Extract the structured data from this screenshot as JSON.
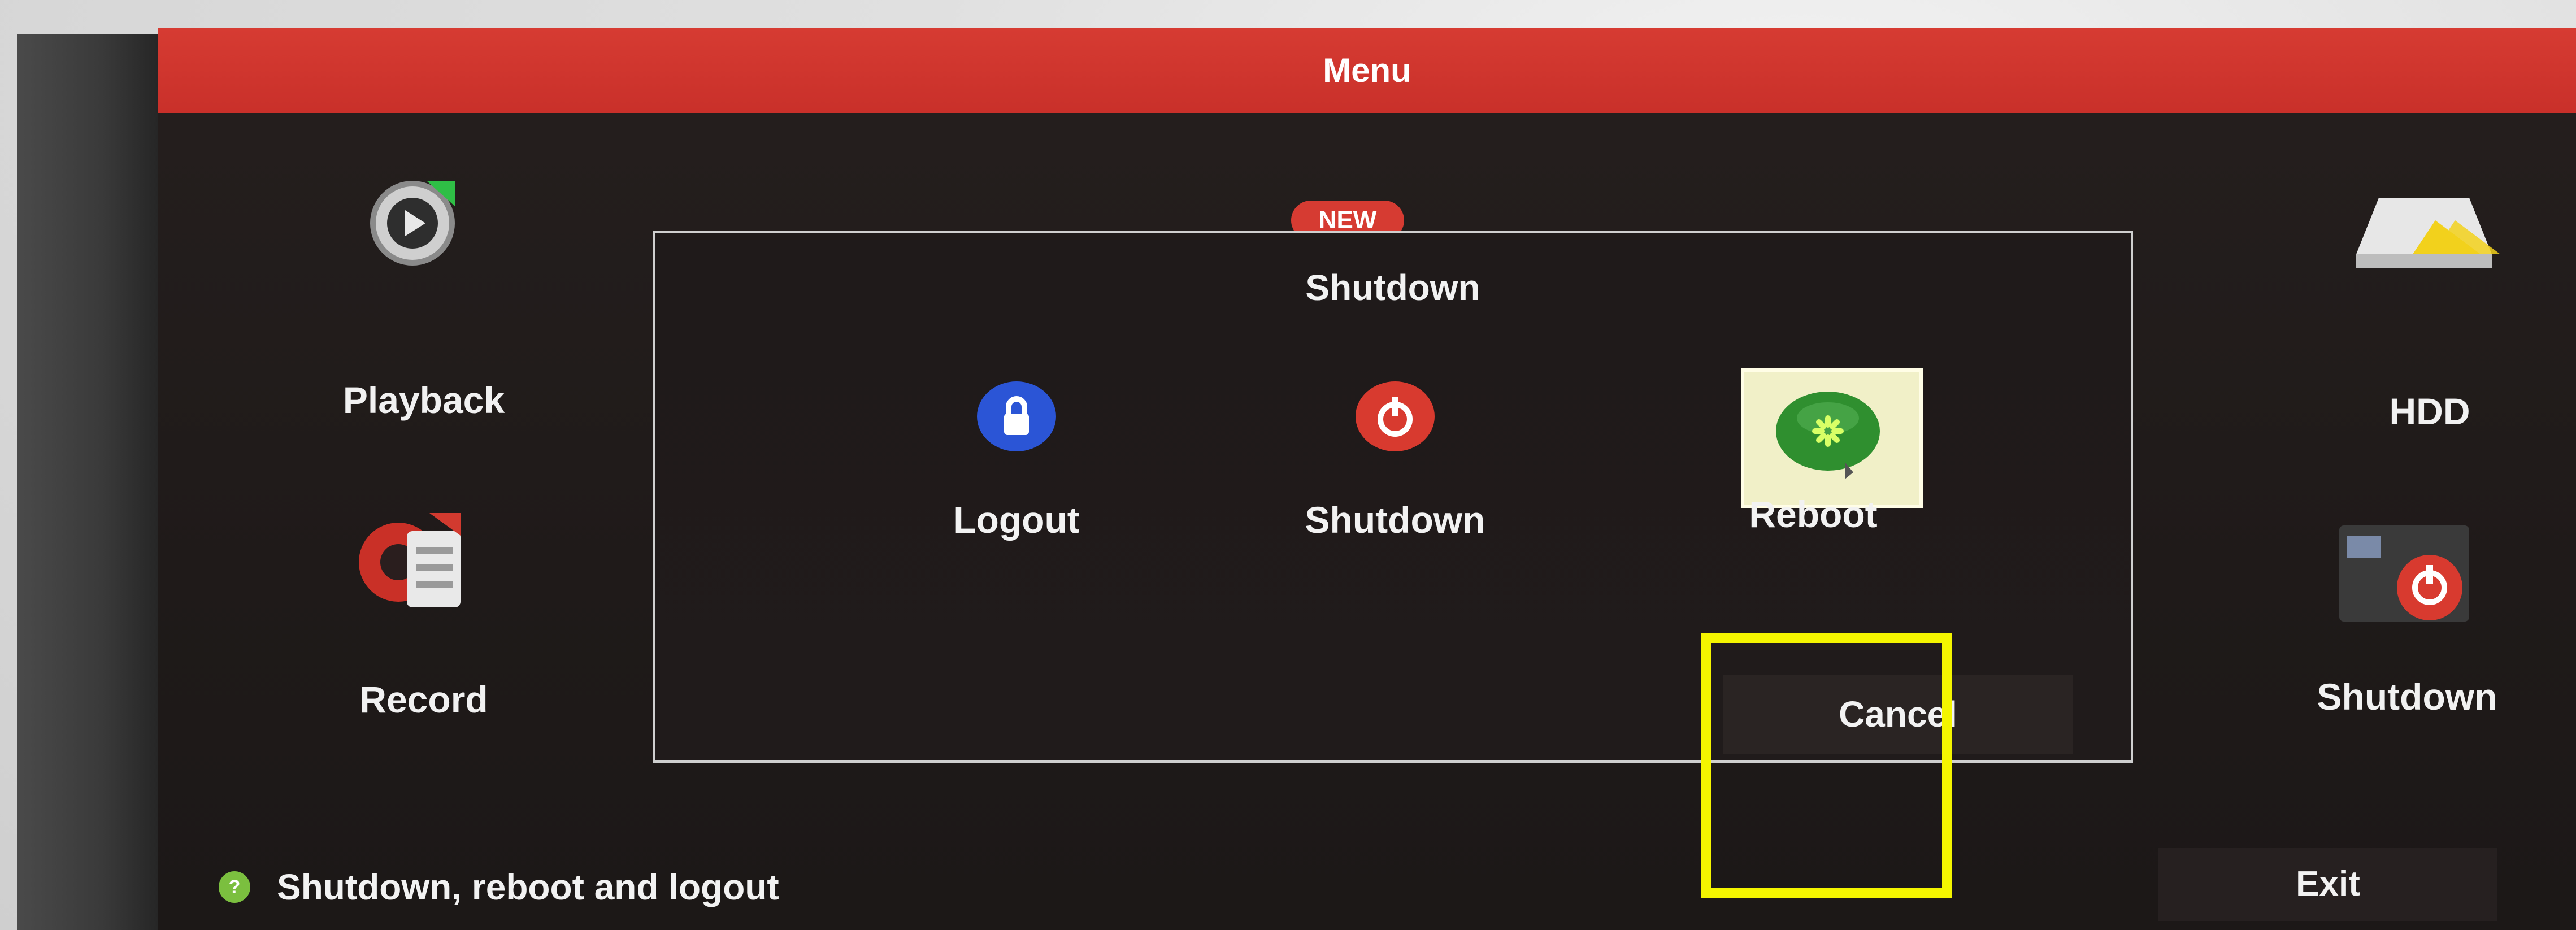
{
  "menu": {
    "title": "Menu"
  },
  "left_items": [
    {
      "label": "Playback",
      "icon": "playback-icon"
    },
    {
      "label": "Record",
      "icon": "record-icon"
    }
  ],
  "right_items": [
    {
      "label": "HDD",
      "icon": "hdd-icon"
    },
    {
      "label": "Shutdown",
      "icon": "shutdown-icon"
    }
  ],
  "badge": {
    "new": "NEW"
  },
  "dialog": {
    "title": "Shutdown",
    "options": [
      {
        "label": "Logout",
        "icon": "lock-icon",
        "color": "#2b55d6"
      },
      {
        "label": "Shutdown",
        "icon": "power-icon",
        "color": "#d83a2f"
      },
      {
        "label": "Reboot",
        "icon": "reboot-icon",
        "color": "#2f8f2f",
        "selected": true
      }
    ],
    "cancel": "Cancel"
  },
  "status": {
    "text": "Shutdown, reboot and logout",
    "icon": "help-icon"
  },
  "exit": "Exit",
  "colors": {
    "accent": "#d63b32",
    "highlight": "#f4f500",
    "selected_bg": "#f1f0c8"
  }
}
